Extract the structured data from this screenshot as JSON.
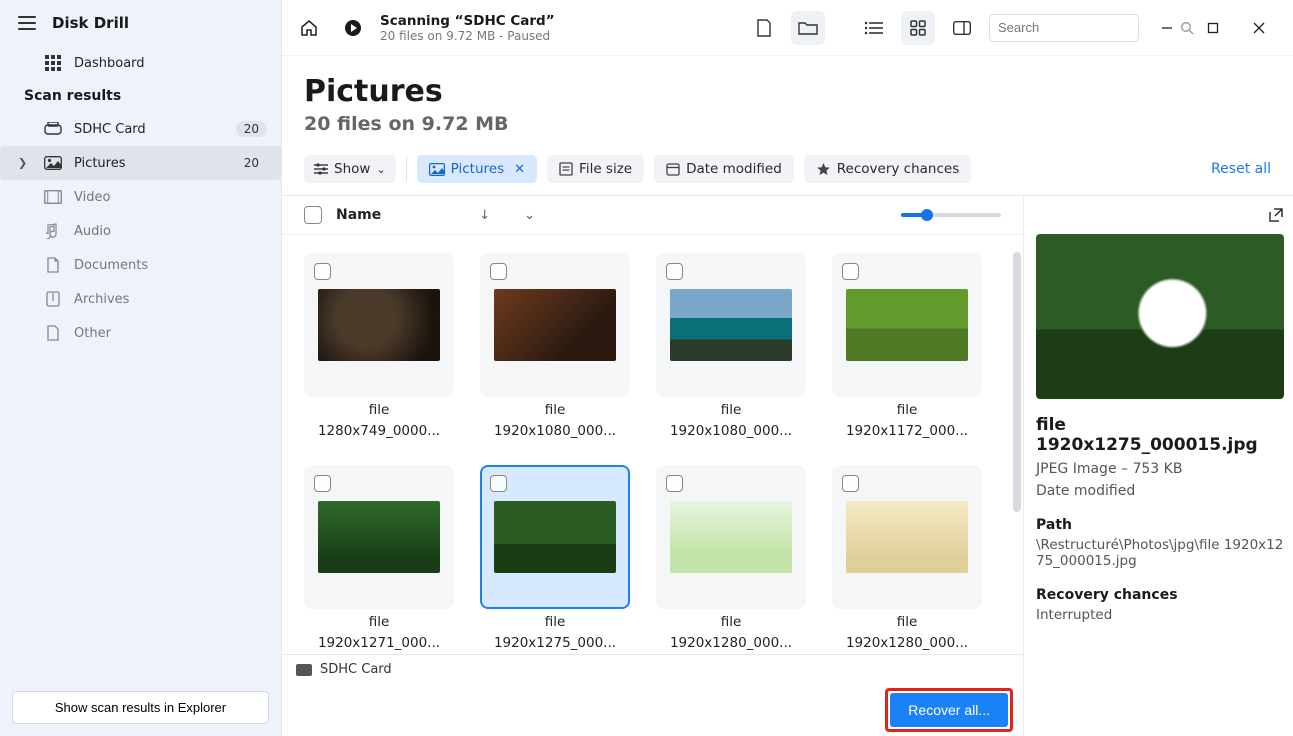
{
  "app": {
    "name": "Disk Drill"
  },
  "sidebar": {
    "dashboard": "Dashboard",
    "section": "Scan results",
    "device": {
      "label": "SDHC Card",
      "count": "20"
    },
    "items": [
      {
        "label": "Pictures",
        "count": "20",
        "active": true
      },
      {
        "label": "Video"
      },
      {
        "label": "Audio"
      },
      {
        "label": "Documents"
      },
      {
        "label": "Archives"
      },
      {
        "label": "Other"
      }
    ],
    "explorer_btn": "Show scan results in Explorer"
  },
  "topbar": {
    "scan_title": "Scanning “SDHC Card”",
    "scan_sub": "20 files on 9.72 MB - Paused",
    "search_placeholder": "Search"
  },
  "page": {
    "title": "Pictures",
    "subtitle": "20 files on 9.72 MB"
  },
  "filters": {
    "show": "Show",
    "pictures": "Pictures",
    "file_size": "File size",
    "date_modified": "Date modified",
    "recovery": "Recovery chances",
    "reset": "Reset all"
  },
  "list_header": {
    "name": "Name"
  },
  "thumbs": [
    {
      "l1": "file",
      "l2": "1280x749_0000..."
    },
    {
      "l1": "file",
      "l2": "1920x1080_000..."
    },
    {
      "l1": "file",
      "l2": "1920x1080_000..."
    },
    {
      "l1": "file",
      "l2": "1920x1172_000..."
    },
    {
      "l1": "file",
      "l2": "1920x1271_000..."
    },
    {
      "l1": "file",
      "l2": "1920x1275_000...",
      "selected": true
    },
    {
      "l1": "file",
      "l2": "1920x1280_000..."
    },
    {
      "l1": "file",
      "l2": "1920x1280_000..."
    }
  ],
  "preview": {
    "title": "file 1920x1275_000015.jpg",
    "meta": "JPEG Image – 753 KB",
    "date_label": "Date modified",
    "path_label": "Path",
    "path_val": "\\Restructuré\\Photos\\jpg\\file 1920x1275_000015.jpg",
    "recovery_label": "Recovery chances",
    "recovery_val": "Interrupted"
  },
  "status_bar": {
    "device": "SDHC Card"
  },
  "footer": {
    "recover": "Recover all..."
  }
}
